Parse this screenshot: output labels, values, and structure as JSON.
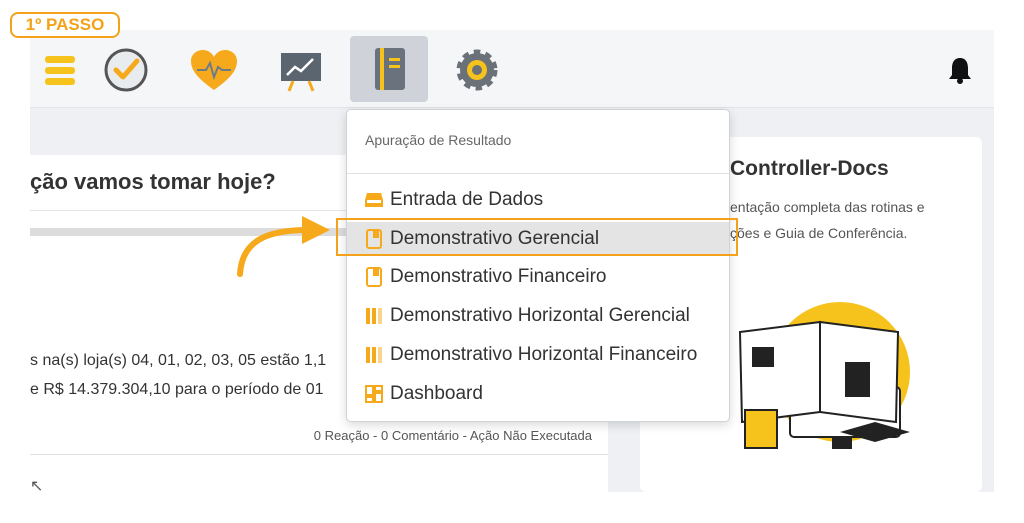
{
  "step_badge": "1º PASSO",
  "nav": {
    "icons": [
      "menu-icon",
      "check-clock-icon",
      "heart-pulse-icon",
      "presentation-chart-icon",
      "notebook-icon",
      "gear-icon"
    ],
    "bell_icon": "bell-icon"
  },
  "left_card": {
    "title": "ção vamos tomar hoje?",
    "line1": "s na(s) loja(s) 04, 01, 02, 03, 05 estão 1,1",
    "line2": "e R$ 14.379.304,10 para o período de 01",
    "stats": "0 Reação - 0 Comentário - Ação Não Executada"
  },
  "right_card": {
    "title": "Controller-Docs",
    "desc1": "entação completa das rotinas e",
    "desc2": "ções e Guia de Conferência."
  },
  "dropdown": {
    "header": "Apuração de Resultado",
    "items": [
      {
        "label": "Entrada de Dados",
        "icon": "inbox-icon"
      },
      {
        "label": "Demonstrativo Gerencial",
        "icon": "book-icon"
      },
      {
        "label": "Demonstrativo Financeiro",
        "icon": "book-icon"
      },
      {
        "label": "Demonstrativo Horizontal Gerencial",
        "icon": "columns-icon"
      },
      {
        "label": "Demonstrativo Horizontal Financeiro",
        "icon": "columns-icon"
      },
      {
        "label": "Dashboard",
        "icon": "dashboard-grid-icon"
      }
    ]
  },
  "colors": {
    "accent": "#f4a21a",
    "icon_yellow": "#f6c21c",
    "navbar": "#f5f6f8",
    "background": "#eef0f3"
  }
}
